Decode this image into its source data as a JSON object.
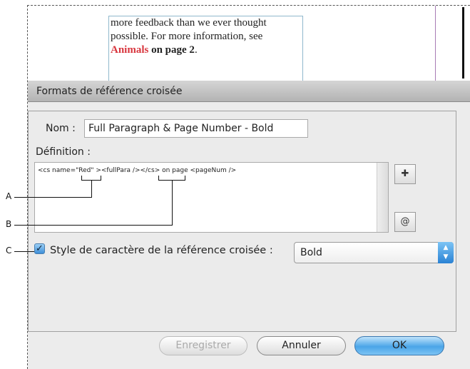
{
  "document": {
    "line1": "more feedback than we ever thought",
    "line2": "possible. For more information, see",
    "link_text": "Animals",
    "page_ref": "on page 2",
    "period": "."
  },
  "dialog": {
    "title": "Formats de référence croisée",
    "name_label": "Nom :",
    "name_value": "Full Paragraph & Page Number - Bold",
    "definition_label": "Définition :",
    "definition_value": "<cs name=\"Red\" ><fullPara /></cs> on page <pageNum />",
    "insert_building_block_icon": "plus-insert-icon",
    "insert_special_char_icon": "at-icon",
    "char_style_label": "Style de caractère de la référence croisée :",
    "char_style_checked": true,
    "char_style_value": "Bold",
    "buttons": {
      "save": "Enregistrer",
      "cancel": "Annuler",
      "ok": "OK"
    }
  },
  "callouts": {
    "a": "A",
    "b": "B",
    "c": "C"
  }
}
